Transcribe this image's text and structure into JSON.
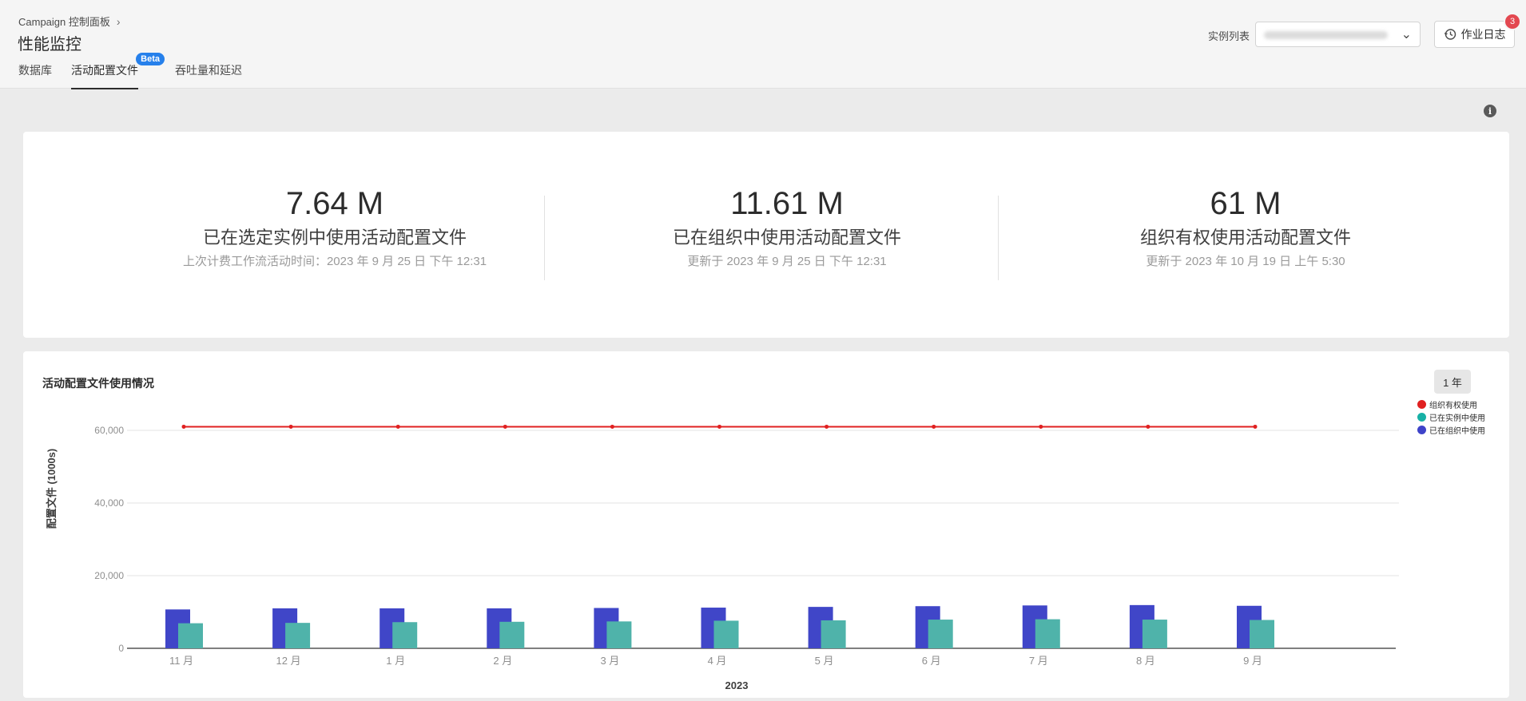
{
  "breadcrumb": {
    "label": "Campaign 控制面板"
  },
  "page_title": "性能监控",
  "tabs": [
    {
      "label": "数据库"
    },
    {
      "label": "活动配置文件",
      "badge": "Beta"
    },
    {
      "label": "吞吐量和延迟"
    }
  ],
  "instance": {
    "label": "实例列表"
  },
  "job_log": {
    "label": "作业日志",
    "badge": "3"
  },
  "stats": [
    {
      "value": "7.64 M",
      "label": "已在选定实例中使用活动配置文件",
      "sub": "上次计费工作流活动时间：2023 年 9 月 25 日 下午 12:31"
    },
    {
      "value": "11.61 M",
      "label": "已在组织中使用活动配置文件",
      "sub": "更新于 2023 年 9 月 25 日 下午 12:31"
    },
    {
      "value": "61 M",
      "label": "组织有权使用活动配置文件",
      "sub": "更新于 2023 年 10 月 19 日 上午 5:30"
    }
  ],
  "chart_panel": {
    "title": "活动配置文件使用情况",
    "range": "1 年"
  },
  "colors": {
    "entitled": "#e02020",
    "instance": "#4fb3aa",
    "org": "#4046c8"
  },
  "chart_data": {
    "type": "bar",
    "xlabel": "2023",
    "ylabel": "配置文件 (1000s)",
    "ylim": [
      0,
      65000
    ],
    "yticks": [
      "0",
      "20,000",
      "40,000",
      "60,000"
    ],
    "ytick_values": [
      0,
      20000,
      40000,
      60000
    ],
    "grid": true,
    "legend_position": "right",
    "categories": [
      "11 月",
      "12 月",
      "1 月",
      "2 月",
      "3 月",
      "4 月",
      "5 月",
      "6 月",
      "7 月",
      "8 月",
      "9 月"
    ],
    "series": [
      {
        "name": "组织有权使用",
        "type": "line",
        "values": [
          61000,
          61000,
          61000,
          61000,
          61000,
          61000,
          61000,
          61000,
          61000,
          61000,
          61000
        ]
      },
      {
        "name": "已在实例中使用",
        "type": "bar",
        "values": [
          6900,
          7000,
          7200,
          7300,
          7400,
          7600,
          7700,
          7900,
          8000,
          7900,
          7800
        ]
      },
      {
        "name": "已在组织中使用",
        "type": "bar",
        "values": [
          10700,
          11000,
          11000,
          11000,
          11100,
          11200,
          11400,
          11600,
          11800,
          11900,
          11700
        ]
      }
    ]
  }
}
